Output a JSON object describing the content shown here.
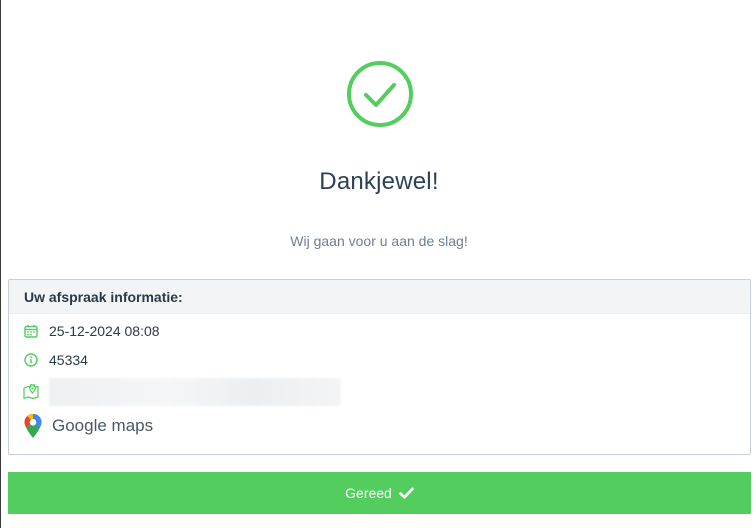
{
  "success": {
    "icon": "check-circle-icon",
    "title": "Dankjewel!",
    "subtitle": "Wij gaan voor u aan de slag!"
  },
  "appointment": {
    "header": "Uw afspraak informatie:",
    "datetime": "25-12-2024 08:08",
    "reference": "45334",
    "maps_label": "Google maps"
  },
  "footer": {
    "done_label": "Gereed"
  },
  "colors": {
    "accent": "#52cd5e",
    "title": "#2b4256",
    "subtitle": "#6b7f95"
  }
}
